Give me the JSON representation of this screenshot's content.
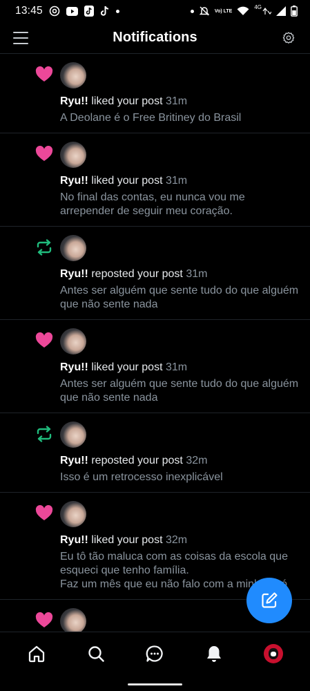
{
  "statusbar": {
    "time": "13:45",
    "network_badge": "Vo) LTE",
    "network_type": "4G"
  },
  "header": {
    "title": "Notifications"
  },
  "notifications": [
    {
      "type": "like",
      "name": "Ryu!!",
      "action": "liked your post",
      "time": "31m",
      "text": "A Deolane é o Free Britiney do Brasil"
    },
    {
      "type": "like",
      "name": "Ryu!!",
      "action": "liked your post",
      "time": "31m",
      "text": "No final das contas, eu nunca vou me arrepender de seguir meu coração."
    },
    {
      "type": "repost",
      "name": "Ryu!!",
      "action": "reposted your post",
      "time": "31m",
      "text": "Antes ser alguém que sente tudo do que alguém que não sente nada"
    },
    {
      "type": "like",
      "name": "Ryu!!",
      "action": "liked your post",
      "time": "31m",
      "text": "Antes ser alguém que sente tudo do que alguém que não sente nada"
    },
    {
      "type": "repost",
      "name": "Ryu!!",
      "action": "reposted your post",
      "time": "32m",
      "text": "Isso é um retrocesso inexplicável"
    },
    {
      "type": "like",
      "name": "Ryu!!",
      "action": "liked your post",
      "time": "32m",
      "text": "Eu tô tão maluca com as coisas da escola que esqueci que tenho família.\nFaz um mês que eu não falo com a minha avó"
    },
    {
      "type": "like",
      "name": "",
      "action": "",
      "time": "",
      "text": ""
    }
  ],
  "colors": {
    "like": "#ec4899",
    "repost": "#20bc7d",
    "accent": "#208bfe",
    "muted": "#8a949e"
  },
  "nav": [
    "home-icon",
    "search-icon",
    "chat-icon",
    "notifications-bell-icon",
    "profile-avatar"
  ]
}
